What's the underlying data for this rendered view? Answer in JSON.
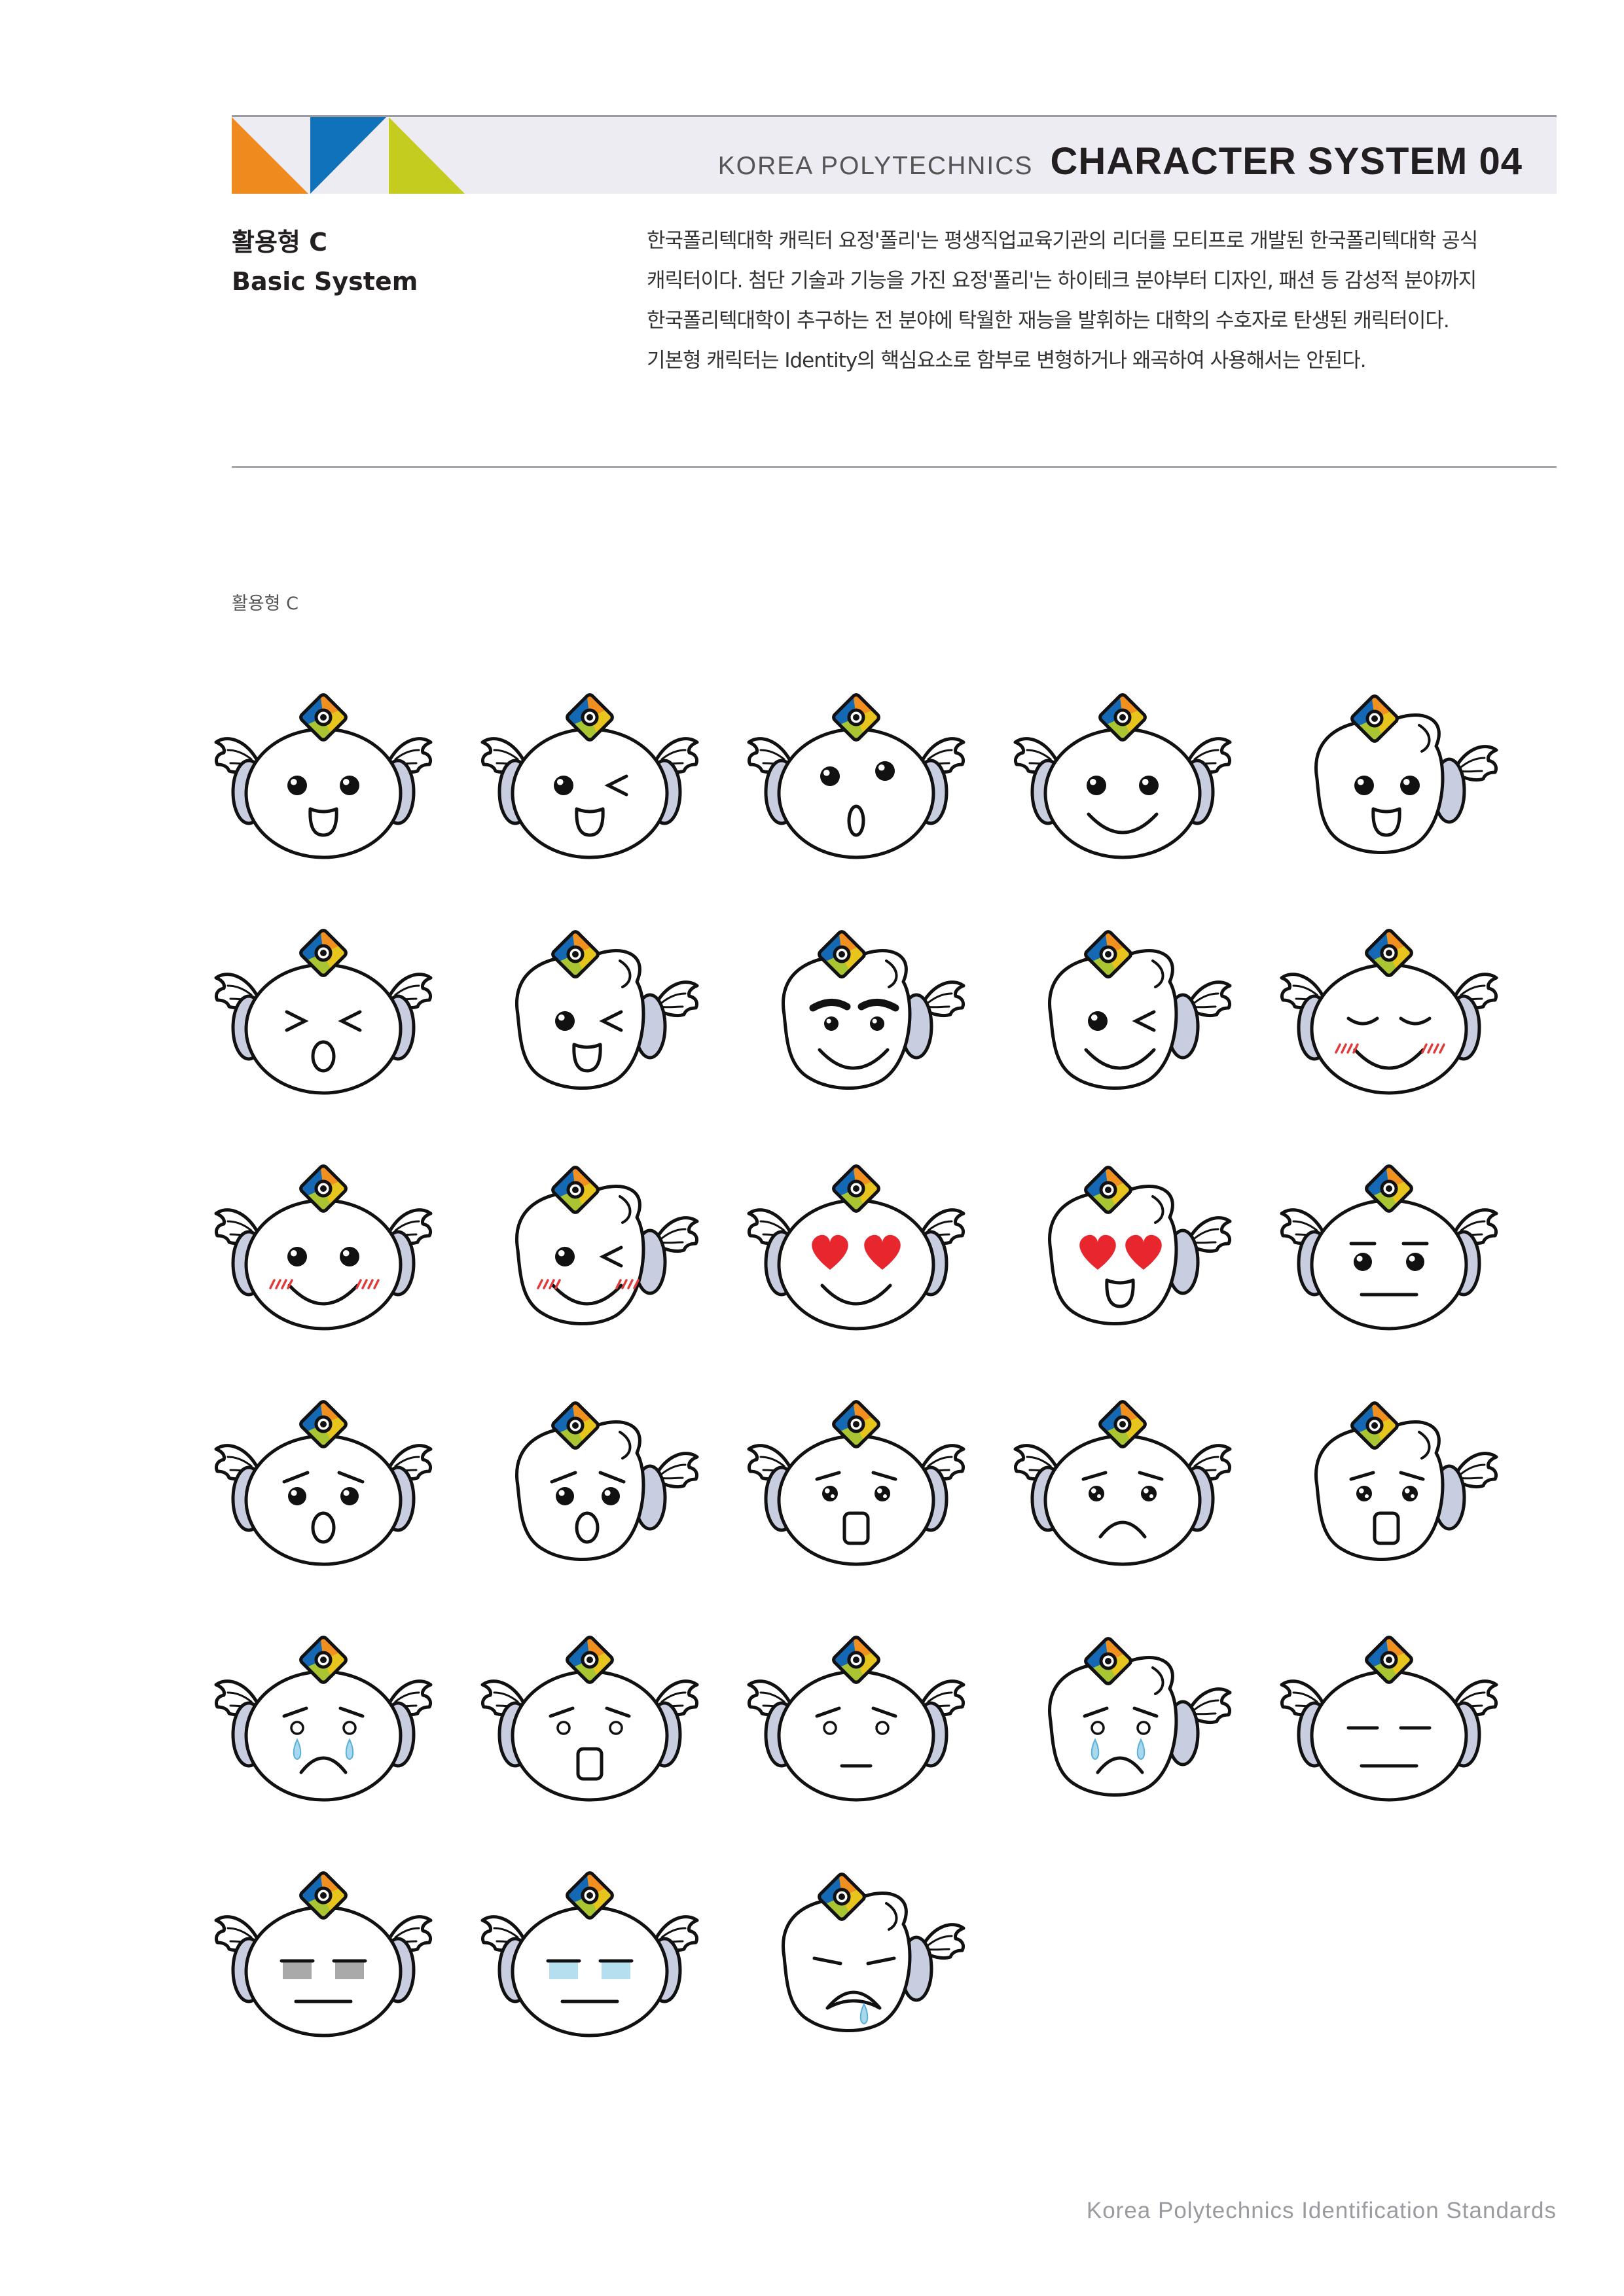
{
  "header": {
    "brand_name": "KOREA POLYTECHNICS",
    "section_title": "CHARACTER SYSTEM 04",
    "colors": {
      "orange": "#ef8a1e",
      "blue": "#0f72ba",
      "lime": "#c4cc1f"
    }
  },
  "section": {
    "title_ko": "활용형 C",
    "title_en": "Basic System"
  },
  "intro": {
    "lines": [
      "한국폴리텍대학 캐릭터 요정'폴리'는 평생직업교육기관의 리더를 모티프로 개발된 한국폴리텍대학 공식",
      "캐릭터이다. 첨단 기술과 기능을 가진 요정'폴리'는 하이테크 분야부터 디자인, 패션 등 감성적 분야까지",
      "한국폴리텍대학이 추구하는 전 분야에 탁월한 재능을 발휘하는 대학의 수호자로 탄생된 캐릭터이다.",
      "기본형 캐릭터는 Identity의 핵심요소로 함부로 변형하거나 왜곡하여 사용해서는 안된다."
    ]
  },
  "caption": "활용형 C",
  "footer": "Korea Polytechnics Identification Standards",
  "character_colors": {
    "outline": "#111111",
    "ear": "#c8cde0",
    "tear": "#a8d8ec",
    "blush": "#e23b3b",
    "heart": "#e8262e",
    "logo_orange": "#f1901f",
    "logo_blue": "#1468b4",
    "logo_yellow": "#e7c51c",
    "logo_lime": "#a9c531"
  },
  "characters": [
    {
      "eyes": "dots",
      "mouth": "open-smile",
      "pose": "front"
    },
    {
      "eyes": "wink",
      "mouth": "open-smile",
      "pose": "front"
    },
    {
      "eyes": "dots-high",
      "mouth": "o-small",
      "pose": "front"
    },
    {
      "eyes": "dots",
      "mouth": "smile",
      "pose": "front"
    },
    {
      "eyes": "dots",
      "mouth": "open-smile",
      "pose": "side"
    },
    {
      "eyes": "squint",
      "mouth": "o-oval",
      "pose": "front"
    },
    {
      "eyes": "wink",
      "mouth": "open-smile",
      "pose": "side"
    },
    {
      "eyes": "brows",
      "mouth": "smile",
      "pose": "side"
    },
    {
      "eyes": "wink",
      "mouth": "smile",
      "pose": "side"
    },
    {
      "eyes": "closed",
      "mouth": "smile",
      "pose": "front",
      "blush": true
    },
    {
      "eyes": "dots",
      "mouth": "smile",
      "pose": "front",
      "blush": true
    },
    {
      "eyes": "wink",
      "mouth": "smile",
      "pose": "side",
      "blush": true
    },
    {
      "eyes": "hearts",
      "mouth": "smile",
      "pose": "front"
    },
    {
      "eyes": "hearts",
      "mouth": "open-smile",
      "pose": "side"
    },
    {
      "eyes": "dots-lidded",
      "mouth": "line",
      "pose": "front"
    },
    {
      "eyes": "worried",
      "mouth": "o-oval",
      "pose": "front"
    },
    {
      "eyes": "worried",
      "mouth": "o-oval",
      "pose": "side"
    },
    {
      "eyes": "sparkle",
      "mouth": "square",
      "pose": "front"
    },
    {
      "eyes": "sparkle",
      "mouth": "frown",
      "pose": "front"
    },
    {
      "eyes": "sparkle",
      "mouth": "square",
      "pose": "side"
    },
    {
      "eyes": "rings",
      "mouth": "frown",
      "pose": "front",
      "tears": true
    },
    {
      "eyes": "rings",
      "mouth": "square",
      "pose": "front"
    },
    {
      "eyes": "rings",
      "mouth": "line-small",
      "pose": "front"
    },
    {
      "eyes": "rings",
      "mouth": "frown",
      "pose": "side",
      "tears": true
    },
    {
      "eyes": "dashes",
      "mouth": "line",
      "pose": "front"
    },
    {
      "eyes": "bars-gray",
      "mouth": "line",
      "pose": "front"
    },
    {
      "eyes": "bars-blue",
      "mouth": "line",
      "pose": "front"
    },
    {
      "eyes": "closed-lines",
      "mouth": "grimace",
      "pose": "side",
      "drool": true
    }
  ]
}
